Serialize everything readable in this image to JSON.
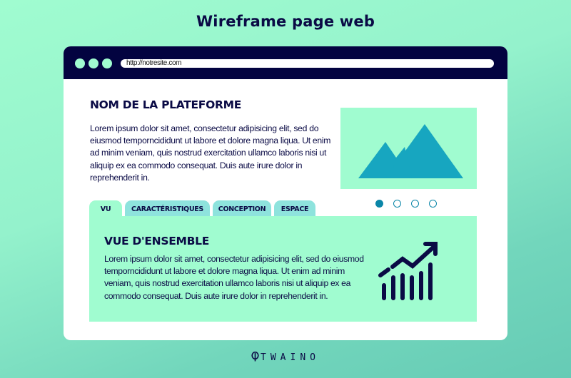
{
  "page": {
    "title": "Wireframe page web",
    "brand": "TWAINO",
    "brand_icon": "leaf-icon"
  },
  "colors": {
    "background": "#a0fcd0",
    "background_dark": "#66cbb5",
    "browser_bar": "#030340",
    "text": "#0a0a45",
    "mint": "#a0fcd0",
    "tab_inactive": "#8ee3dd",
    "mountain": "#17a6c0",
    "carousel_dot": "#0b86a8"
  },
  "browser": {
    "window_controls": [
      "circle",
      "circle",
      "circle"
    ],
    "url": "http://notresite.com"
  },
  "header_section": {
    "heading": "NOM DE LA PLATEFORME",
    "body": "Lorem ipsum dolor sit amet, consectetur adipisicing elit, sed do eiusmod temporncididunt ut labore et dolore magna liqua. Ut enim ad minim veniam, quis nostrud exercitation ullamco laboris nisi ut aliquip ex ea commodo consequat. Duis aute irure dolor in reprehenderit in.",
    "image_icon": "mountain-image-icon"
  },
  "carousel": {
    "count": 4,
    "active_index": 0
  },
  "tabs": [
    {
      "label": "VU",
      "active": true
    },
    {
      "label": "CARACTÉRISTIQUES",
      "active": false
    },
    {
      "label": "CONCEPTION",
      "active": false
    },
    {
      "label": "ESPACE",
      "active": false
    }
  ],
  "panel": {
    "heading": "VUE D'ENSEMBLE",
    "body": "Lorem ipsum dolor sit amet, consectetur adipisicing elit, sed do eiusmod temporncididunt ut labore et dolore magna liqua. Ut enim ad minim veniam, quis nostrud exercitation ullamco laboris nisi ut aliquip ex ea commodo consequat. Duis aute irure dolor in reprehenderit in.",
    "icon": "growth-chart-icon"
  }
}
